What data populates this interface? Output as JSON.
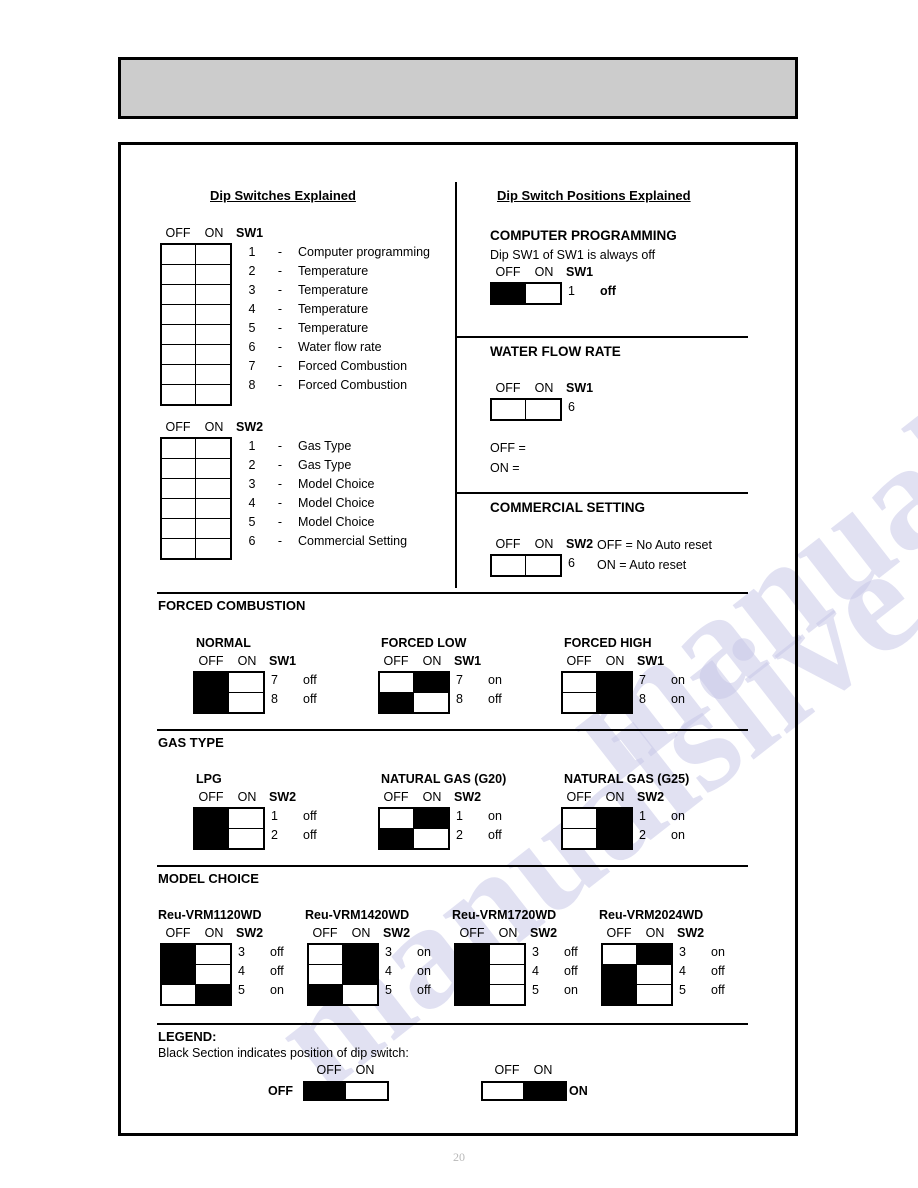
{
  "page": {
    "number": "20",
    "watermark_text": "manualslive.com"
  },
  "left_column": {
    "title": "Dip Switches Explained",
    "sw1": {
      "label_off": "OFF",
      "label_on": "ON",
      "label_switch": "SW1",
      "rows": [
        {
          "num": "1",
          "dash": "-",
          "text": "Computer programming"
        },
        {
          "num": "2",
          "dash": "-",
          "text": "Temperature"
        },
        {
          "num": "3",
          "dash": "-",
          "text": "Temperature"
        },
        {
          "num": "4",
          "dash": "-",
          "text": "Temperature"
        },
        {
          "num": "5",
          "dash": "-",
          "text": "Temperature"
        },
        {
          "num": "6",
          "dash": "-",
          "text": "Water flow rate"
        },
        {
          "num": "7",
          "dash": "-",
          "text": "Forced Combustion"
        },
        {
          "num": "8",
          "dash": "-",
          "text": "Forced Combustion"
        }
      ]
    },
    "sw2": {
      "label_off": "OFF",
      "label_on": "ON",
      "label_switch": "SW2",
      "rows": [
        {
          "num": "1",
          "dash": "-",
          "text": "Gas Type"
        },
        {
          "num": "2",
          "dash": "-",
          "text": "Gas Type"
        },
        {
          "num": "3",
          "dash": "-",
          "text": "Model Choice"
        },
        {
          "num": "4",
          "dash": "-",
          "text": "Model Choice"
        },
        {
          "num": "5",
          "dash": "-",
          "text": "Model Choice"
        },
        {
          "num": "6",
          "dash": "-",
          "text": "Commercial Setting"
        }
      ]
    }
  },
  "right_column": {
    "title": "Dip Switch Positions Explained",
    "computer_programming": {
      "heading": "COMPUTER PROGRAMMING",
      "note": "Dip SW1 of SW1 is always off",
      "label_off": "OFF",
      "label_on": "ON",
      "label_switch": "SW1",
      "row_num": "1",
      "row_state": "off"
    },
    "water_flow_rate": {
      "heading": "WATER FLOW RATE",
      "label_off": "OFF",
      "label_on": "ON",
      "label_switch": "SW1",
      "row_num": "6",
      "legend_off": "OFF =",
      "legend_on": "ON ="
    },
    "commercial_setting": {
      "heading": "COMMERCIAL SETTING",
      "label_off": "OFF",
      "label_on": "ON",
      "label_switch": "SW2",
      "row_num": "6",
      "legend_off": "OFF = No Auto reset",
      "legend_on": "ON = Auto reset"
    }
  },
  "forced_combustion": {
    "section_title": "FORCED COMBUSTION",
    "items": [
      {
        "name": "NORMAL",
        "label_off": "OFF",
        "label_on": "ON",
        "label_switch": "SW1",
        "rows": [
          {
            "num": "7",
            "state": "off",
            "filled": "off"
          },
          {
            "num": "8",
            "state": "off",
            "filled": "off"
          }
        ]
      },
      {
        "name": "FORCED LOW",
        "label_off": "OFF",
        "label_on": "ON",
        "label_switch": "SW1",
        "rows": [
          {
            "num": "7",
            "state": "on",
            "filled": "on"
          },
          {
            "num": "8",
            "state": "off",
            "filled": "off"
          }
        ]
      },
      {
        "name": "FORCED HIGH",
        "label_off": "OFF",
        "label_on": "ON",
        "label_switch": "SW1",
        "rows": [
          {
            "num": "7",
            "state": "on",
            "filled": "on"
          },
          {
            "num": "8",
            "state": "on",
            "filled": "on"
          }
        ]
      }
    ]
  },
  "gas_type": {
    "section_title": "GAS TYPE",
    "items": [
      {
        "name": "LPG",
        "label_off": "OFF",
        "label_on": "ON",
        "label_switch": "SW2",
        "rows": [
          {
            "num": "1",
            "state": "off",
            "filled": "off"
          },
          {
            "num": "2",
            "state": "off",
            "filled": "off"
          }
        ]
      },
      {
        "name": "NATURAL GAS (G20)",
        "label_off": "OFF",
        "label_on": "ON",
        "label_switch": "SW2",
        "rows": [
          {
            "num": "1",
            "state": "on",
            "filled": "on"
          },
          {
            "num": "2",
            "state": "off",
            "filled": "off"
          }
        ]
      },
      {
        "name": "NATURAL GAS (G25)",
        "label_off": "OFF",
        "label_on": "ON",
        "label_switch": "SW2",
        "rows": [
          {
            "num": "1",
            "state": "on",
            "filled": "on"
          },
          {
            "num": "2",
            "state": "on",
            "filled": "on"
          }
        ]
      }
    ]
  },
  "model_choice": {
    "section_title": "MODEL CHOICE",
    "items": [
      {
        "name": "Reu-VRM1120WD",
        "label_off": "OFF",
        "label_on": "ON",
        "label_switch": "SW2",
        "rows": [
          {
            "num": "3",
            "state": "off",
            "filled": "off"
          },
          {
            "num": "4",
            "state": "off",
            "filled": "off"
          },
          {
            "num": "5",
            "state": "on",
            "filled": "on"
          }
        ]
      },
      {
        "name": "Reu-VRM1420WD",
        "label_off": "OFF",
        "label_on": "ON",
        "label_switch": "SW2",
        "rows": [
          {
            "num": "3",
            "state": "on",
            "filled": "on"
          },
          {
            "num": "4",
            "state": "on",
            "filled": "on"
          },
          {
            "num": "5",
            "state": "off",
            "filled": "off"
          }
        ]
      },
      {
        "name": "Reu-VRM1720WD",
        "label_off": "OFF",
        "label_on": "ON",
        "label_switch": "SW2",
        "rows": [
          {
            "num": "3",
            "state": "off",
            "filled": "off"
          },
          {
            "num": "4",
            "state": "off",
            "filled": "off"
          },
          {
            "num": "5",
            "state": "on",
            "filled": "off"
          }
        ]
      },
      {
        "name": "Reu-VRM2024WD",
        "label_off": "OFF",
        "label_on": "ON",
        "label_switch": "SW2",
        "rows": [
          {
            "num": "3",
            "state": "on",
            "filled": "on"
          },
          {
            "num": "4",
            "state": "off",
            "filled": "off"
          },
          {
            "num": "5",
            "state": "off",
            "filled": "off"
          }
        ]
      }
    ]
  },
  "legend": {
    "title": "LEGEND:",
    "description": "Black Section indicates position of dip switch:",
    "off_example": {
      "side_label": "OFF",
      "label_off": "OFF",
      "label_on": "ON",
      "filled": "off"
    },
    "on_example": {
      "side_label": "ON",
      "label_off": "OFF",
      "label_on": "ON",
      "filled": "on"
    }
  }
}
